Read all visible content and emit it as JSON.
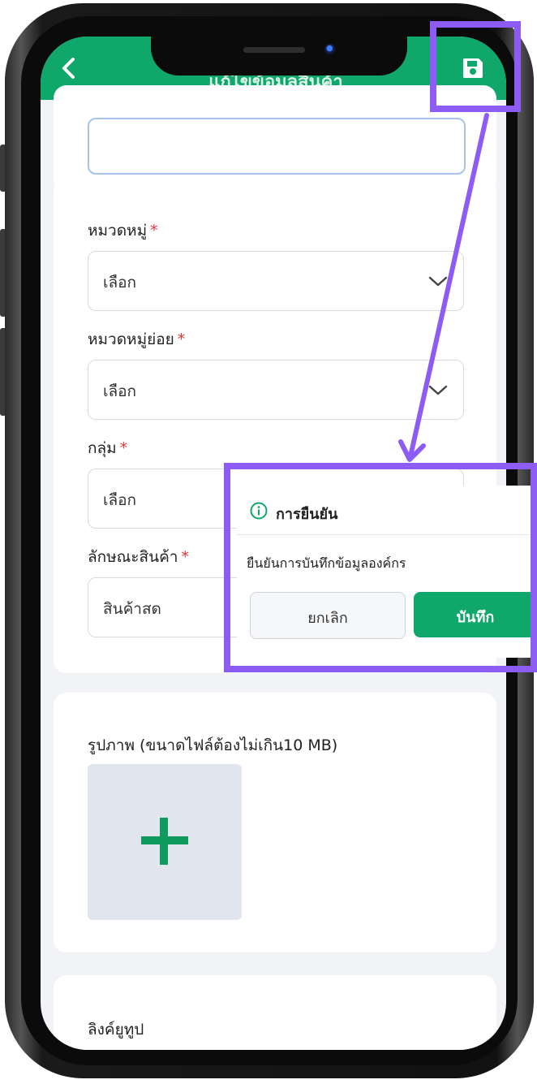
{
  "header": {
    "title": "แก้ไขข้อมูลสินค้า",
    "back_icon": "chevron-left-icon",
    "save_icon": "floppy-disk-icon",
    "bg_color": "#0fa86a"
  },
  "form": {
    "category": {
      "label": "หมวดหมู่",
      "required_mark": "*",
      "value": "เลือก"
    },
    "subcategory": {
      "label": "หมวดหมู่ย่อย",
      "required_mark": "*",
      "value": "เลือก"
    },
    "group": {
      "label": "กลุ่ม",
      "required_mark": "*",
      "value": "เลือก"
    },
    "product_type": {
      "label": "ลักษณะสินค้า",
      "required_mark": "*",
      "value": "สินค้าสด"
    },
    "image_upload": {
      "label": "รูปภาพ (ขนาดไฟล์ต้องไม่เกิน10 MB)",
      "icon": "plus-icon"
    },
    "youtube": {
      "label": "ลิงค์ยูทูป"
    }
  },
  "dialog": {
    "title": "การยืนยัน",
    "icon": "info-circle-icon",
    "message": "ยืนยันการบันทึกข้อมูลองค์กร",
    "cancel_label": "ยกเลิก",
    "confirm_label": "บันทึก"
  },
  "annotation": {
    "color": "#8c5cf5"
  }
}
